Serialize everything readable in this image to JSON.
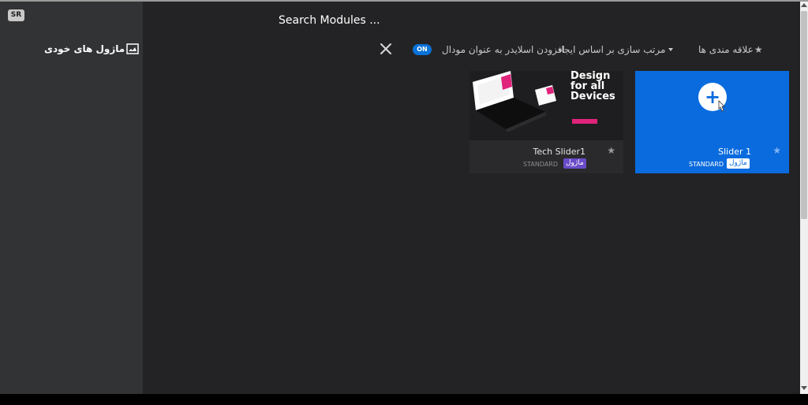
{
  "sidebar": {
    "badge": "SR",
    "my_modules": "ماژول های خودی",
    "my_modules_icon": "image-icon"
  },
  "search": {
    "placeholder": "Search Modules ..."
  },
  "toolbar": {
    "favorites": "علاقه مندی ها",
    "favorites_icon": "star-icon",
    "sort": "مرتب سازی بر اساس ایجاد",
    "modal_label": "افزودن اسلایدر به عنوان مودال",
    "toggle": "ON",
    "close_icon": "close-icon"
  },
  "cards": [
    {
      "title": "Tech Slider1",
      "type": "STANDARD",
      "badge": "ماژول",
      "thumb_lines": [
        "Design",
        "for all",
        "Devices"
      ]
    },
    {
      "title": "Slider 1",
      "type": "STANDARD",
      "badge": "ماژول",
      "plus": "+"
    }
  ],
  "colors": {
    "accent": "#0a6bde",
    "sidebar_bg": "#323335",
    "main_bg": "#232325",
    "badge_purple": "#6a4bc8",
    "thumb_pink": "#e0237b"
  }
}
